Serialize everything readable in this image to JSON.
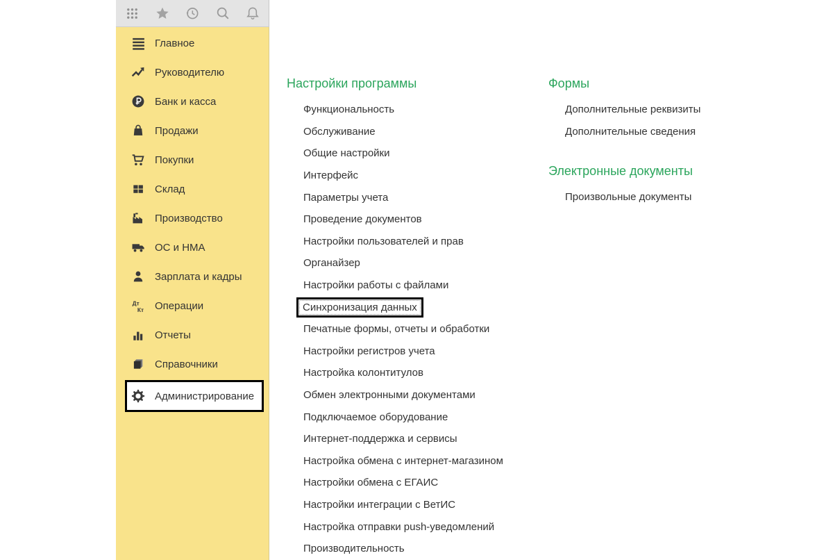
{
  "colors": {
    "sidebar_yellow": "#f9e38b",
    "toolbar_gray": "#e4e4e4",
    "accent_green": "#2ba55c",
    "annotation_black": "#000000",
    "text_dark": "#333333"
  },
  "topbar": {
    "icons": [
      "apps-grid",
      "favorites-star",
      "history-clock",
      "search",
      "notifications-bell"
    ]
  },
  "sidebar": {
    "items": [
      {
        "key": "glavnoe",
        "icon": "menu",
        "label": "Главное"
      },
      {
        "key": "rukovoditelyu",
        "icon": "trend",
        "label": "Руководителю"
      },
      {
        "key": "bank-i-kassa",
        "icon": "ruble",
        "label": "Банк и касса"
      },
      {
        "key": "prodazhi",
        "icon": "bag",
        "label": "Продажи"
      },
      {
        "key": "pokupki",
        "icon": "cart",
        "label": "Покупки"
      },
      {
        "key": "sklad",
        "icon": "grid",
        "label": "Склад"
      },
      {
        "key": "proizvodstvo",
        "icon": "factory",
        "label": "Производство"
      },
      {
        "key": "os-i-nma",
        "icon": "truck",
        "label": "ОС и НМА"
      },
      {
        "key": "zarplata-i-kadry",
        "icon": "person",
        "label": "Зарплата и кадры"
      },
      {
        "key": "operacii",
        "icon": "dtkt",
        "label": "Операции"
      },
      {
        "key": "otchety",
        "icon": "chart",
        "label": "Отчеты"
      },
      {
        "key": "spravochniki",
        "icon": "books",
        "label": "Справочники"
      },
      {
        "key": "administrirovanie",
        "icon": "gear",
        "label": "Администрирование",
        "active": true
      }
    ]
  },
  "main": {
    "settings": {
      "title": "Настройки программы",
      "items": [
        {
          "label": "Функциональность"
        },
        {
          "label": "Обслуживание"
        },
        {
          "label": "Общие настройки"
        },
        {
          "label": "Интерфейс"
        },
        {
          "label": "Параметры учета"
        },
        {
          "label": "Проведение документов"
        },
        {
          "label": "Настройки пользователей и прав"
        },
        {
          "label": "Органайзер"
        },
        {
          "label": "Настройки работы с файлами"
        },
        {
          "label": "Синхронизация данных",
          "boxed": true
        },
        {
          "label": "Печатные формы, отчеты и обработки"
        },
        {
          "label": "Настройки регистров учета"
        },
        {
          "label": "Настройка колонтитулов"
        },
        {
          "label": "Обмен электронными документами"
        },
        {
          "label": "Подключаемое оборудование"
        },
        {
          "label": "Интернет-поддержка и сервисы"
        },
        {
          "label": "Настройка обмена с интернет-магазином"
        },
        {
          "label": "Настройки обмена с ЕГАИС"
        },
        {
          "label": "Настройки интеграции с ВетИС"
        },
        {
          "label": "Настройка отправки push-уведомлений"
        },
        {
          "label": "Производительность"
        }
      ]
    },
    "forms": {
      "title": "Формы",
      "items": [
        {
          "label": "Дополнительные реквизиты"
        },
        {
          "label": "Дополнительные сведения"
        }
      ]
    },
    "edocs": {
      "title": "Электронные документы",
      "items": [
        {
          "label": "Произвольные документы"
        }
      ]
    }
  }
}
